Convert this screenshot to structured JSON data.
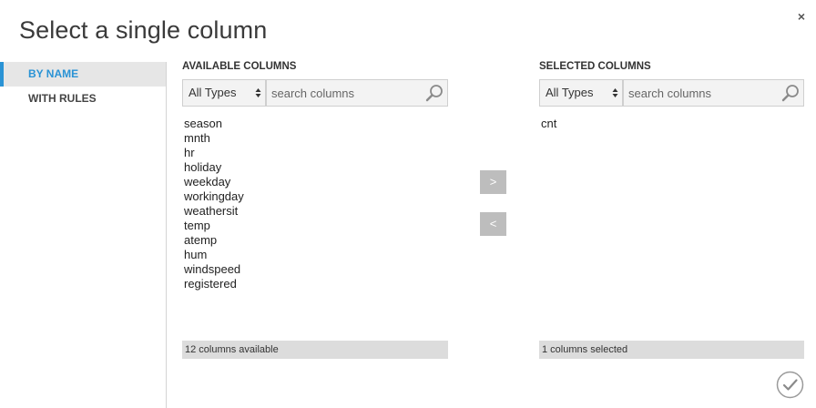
{
  "dialog": {
    "title": "Select a single column",
    "close_label": "×"
  },
  "sidebar": {
    "items": [
      {
        "label": "BY NAME",
        "active": true
      },
      {
        "label": "WITH RULES",
        "active": false
      }
    ]
  },
  "available": {
    "heading": "AVAILABLE COLUMNS",
    "type_filter": "All Types",
    "search_placeholder": "search columns",
    "columns": [
      "season",
      "mnth",
      "hr",
      "holiday",
      "weekday",
      "workingday",
      "weathersit",
      "temp",
      "atemp",
      "hum",
      "windspeed",
      "registered"
    ],
    "status": "12 columns available"
  },
  "selected": {
    "heading": "SELECTED COLUMNS",
    "type_filter": "All Types",
    "search_placeholder": "search columns",
    "columns": [
      "cnt"
    ],
    "status": "1 columns selected"
  },
  "actions": {
    "add_label": ">",
    "remove_label": "<"
  },
  "colors": {
    "accent": "#2a93d5",
    "button_gray": "#bdbdbd",
    "status_bg": "#dcdcdc"
  }
}
